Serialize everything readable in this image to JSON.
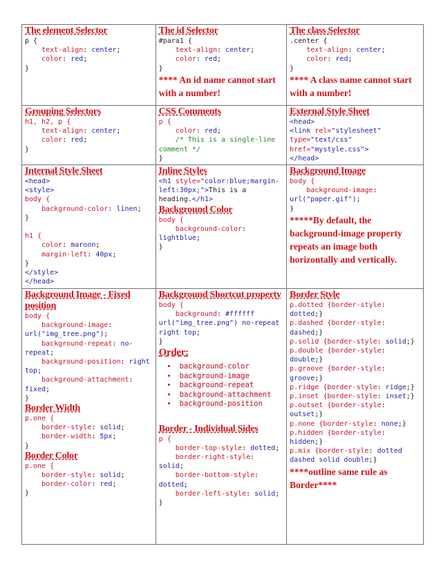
{
  "document": {
    "title": "CSS Cheat Sheet Table",
    "colors": {
      "heading": "#d0141b",
      "property": "#c4142a",
      "value": "#1f1fa0",
      "comment": "#1f8a1f",
      "border": "#707070"
    },
    "cells": {
      "element_selector": {
        "heading": "The element Selector",
        "selector": "p {",
        "lines": [
          {
            "prop": "text-align",
            "val": "center"
          },
          {
            "prop": "color",
            "val": "red"
          }
        ],
        "close": "}"
      },
      "id_selector": {
        "heading": "The id Selector",
        "selector": "#para1 {",
        "lines": [
          {
            "prop": "text-align",
            "val": "center"
          },
          {
            "prop": "color",
            "val": "red"
          }
        ],
        "close": "}",
        "note": "**** An id name cannot start with a number!"
      },
      "class_selector": {
        "heading": "The class Selector",
        "selector": ".center {",
        "lines": [
          {
            "prop": "text-align",
            "val": "center"
          },
          {
            "prop": "color",
            "val": "red"
          }
        ],
        "close": "}",
        "note": "**** A class name cannot start with a number!"
      },
      "grouping_selectors": {
        "heading": "Grouping Selectors",
        "selector": "h1, h2, p {",
        "lines": [
          {
            "prop": "text-align",
            "val": "center"
          },
          {
            "prop": "color",
            "val": "red"
          }
        ],
        "close": "}"
      },
      "css_comments": {
        "heading": "CSS Comments",
        "selector": "p {",
        "lines": [
          {
            "prop": "color",
            "val": "red"
          }
        ],
        "comment": "/* This is a single-line comment */",
        "close": "}"
      },
      "external_style_sheet": {
        "heading": "External Style Sheet",
        "head_open": "<head>",
        "link_tag": "<link",
        "rel_attr": "rel=",
        "rel_val": "\"stylesheet\"",
        "type_attr": "type=",
        "type_val": "\"text/css\"",
        "href_attr": "href=",
        "href_val": "\"mystyle.css\">",
        "head_close": "</head>"
      },
      "internal_style_sheet": {
        "heading": "Internal Style Sheet",
        "head_open": "<head>",
        "style_open": "<style>",
        "body_selector": "body {",
        "body_lines": [
          {
            "prop": "background-color",
            "val": "linen"
          }
        ],
        "h1_selector": "h1 {",
        "h1_lines": [
          {
            "prop": "color",
            "val": "maroon"
          },
          {
            "prop": "margin-left",
            "val": "40px"
          }
        ],
        "close": "}",
        "style_close": "</style>",
        "head_close": "</head>"
      },
      "inline_styles": {
        "heading": "Inline Styles",
        "tag_open": "<h1",
        "style_attr": "style=",
        "style_val": "\"color:blue;margin-left:30px;\"",
        "gt": ">",
        "text": "This is a heading.",
        "tag_close": "</h1>"
      },
      "background_color": {
        "heading": "Background Color",
        "selector": "body {",
        "prop": "background-color",
        "val": "lightblue",
        "close": "}"
      },
      "background_image": {
        "heading": "Background Image",
        "selector": "body {",
        "prop": "background-image",
        "val": "url(\"paper.gif\")",
        "close": "}",
        "note": "*****By default, the background-image property repeats an image both horizontally and vertically."
      },
      "background_image_fixed": {
        "heading": "Background Image - Fixed position",
        "selector": "body {",
        "lines": [
          {
            "prop": "background-image",
            "val": "url(\"img_tree.png\")"
          },
          {
            "prop": "background-repeat",
            "val": "no-repeat"
          },
          {
            "prop": "background-position",
            "val": "right top"
          },
          {
            "prop": "background-attachment",
            "val": "fixed"
          }
        ],
        "close": "}"
      },
      "border_width": {
        "heading": "Border Width",
        "selector": "p.one {",
        "lines": [
          {
            "prop": "border-style",
            "val": "solid"
          },
          {
            "prop": "border-width",
            "val": "5px"
          }
        ],
        "close": "}"
      },
      "border_color": {
        "heading": "Border Color",
        "selector": "p.one {",
        "lines": [
          {
            "prop": "border-style",
            "val": "solid"
          },
          {
            "prop": "border-color",
            "val": "red"
          }
        ],
        "close": "}"
      },
      "background_shortcut": {
        "heading": "Background Shortcut property",
        "selector": "body {",
        "prop": "background",
        "val": "#ffffff url(\"img_tree.png\") no-repeat right top",
        "close": "}",
        "order_heading": "Order:",
        "order": [
          "background-color",
          "background-image",
          "background-repeat",
          "background-attachment",
          "background-position"
        ]
      },
      "border_individual_sides": {
        "heading": "Border - Individual Sides",
        "selector": "p {",
        "lines": [
          {
            "prop": "border-top-style",
            "val": "dotted"
          },
          {
            "prop": "border-right-style",
            "val": "solid"
          },
          {
            "prop": "border-bottom-style",
            "val": "dotted"
          },
          {
            "prop": "border-left-style",
            "val": "solid"
          }
        ],
        "close": "}"
      },
      "border_style": {
        "heading": "Border Style",
        "rules": [
          {
            "sel": "p.dotted",
            "val": "dotted"
          },
          {
            "sel": "p.dashed",
            "val": "dashed"
          },
          {
            "sel": "p.solid",
            "val": "solid"
          },
          {
            "sel": "p.double",
            "val": "double"
          },
          {
            "sel": "p.groove",
            "val": "groove"
          },
          {
            "sel": "p.ridge",
            "val": "ridge"
          },
          {
            "sel": "p.inset",
            "val": "inset"
          },
          {
            "sel": "p.outset",
            "val": "outset"
          },
          {
            "sel": "p.none",
            "val": "none"
          },
          {
            "sel": "p.hidden",
            "val": "hidden"
          },
          {
            "sel": "p.mix",
            "val": "dotted dashed solid double"
          }
        ],
        "note": "****outline same rule as Border****"
      }
    }
  }
}
